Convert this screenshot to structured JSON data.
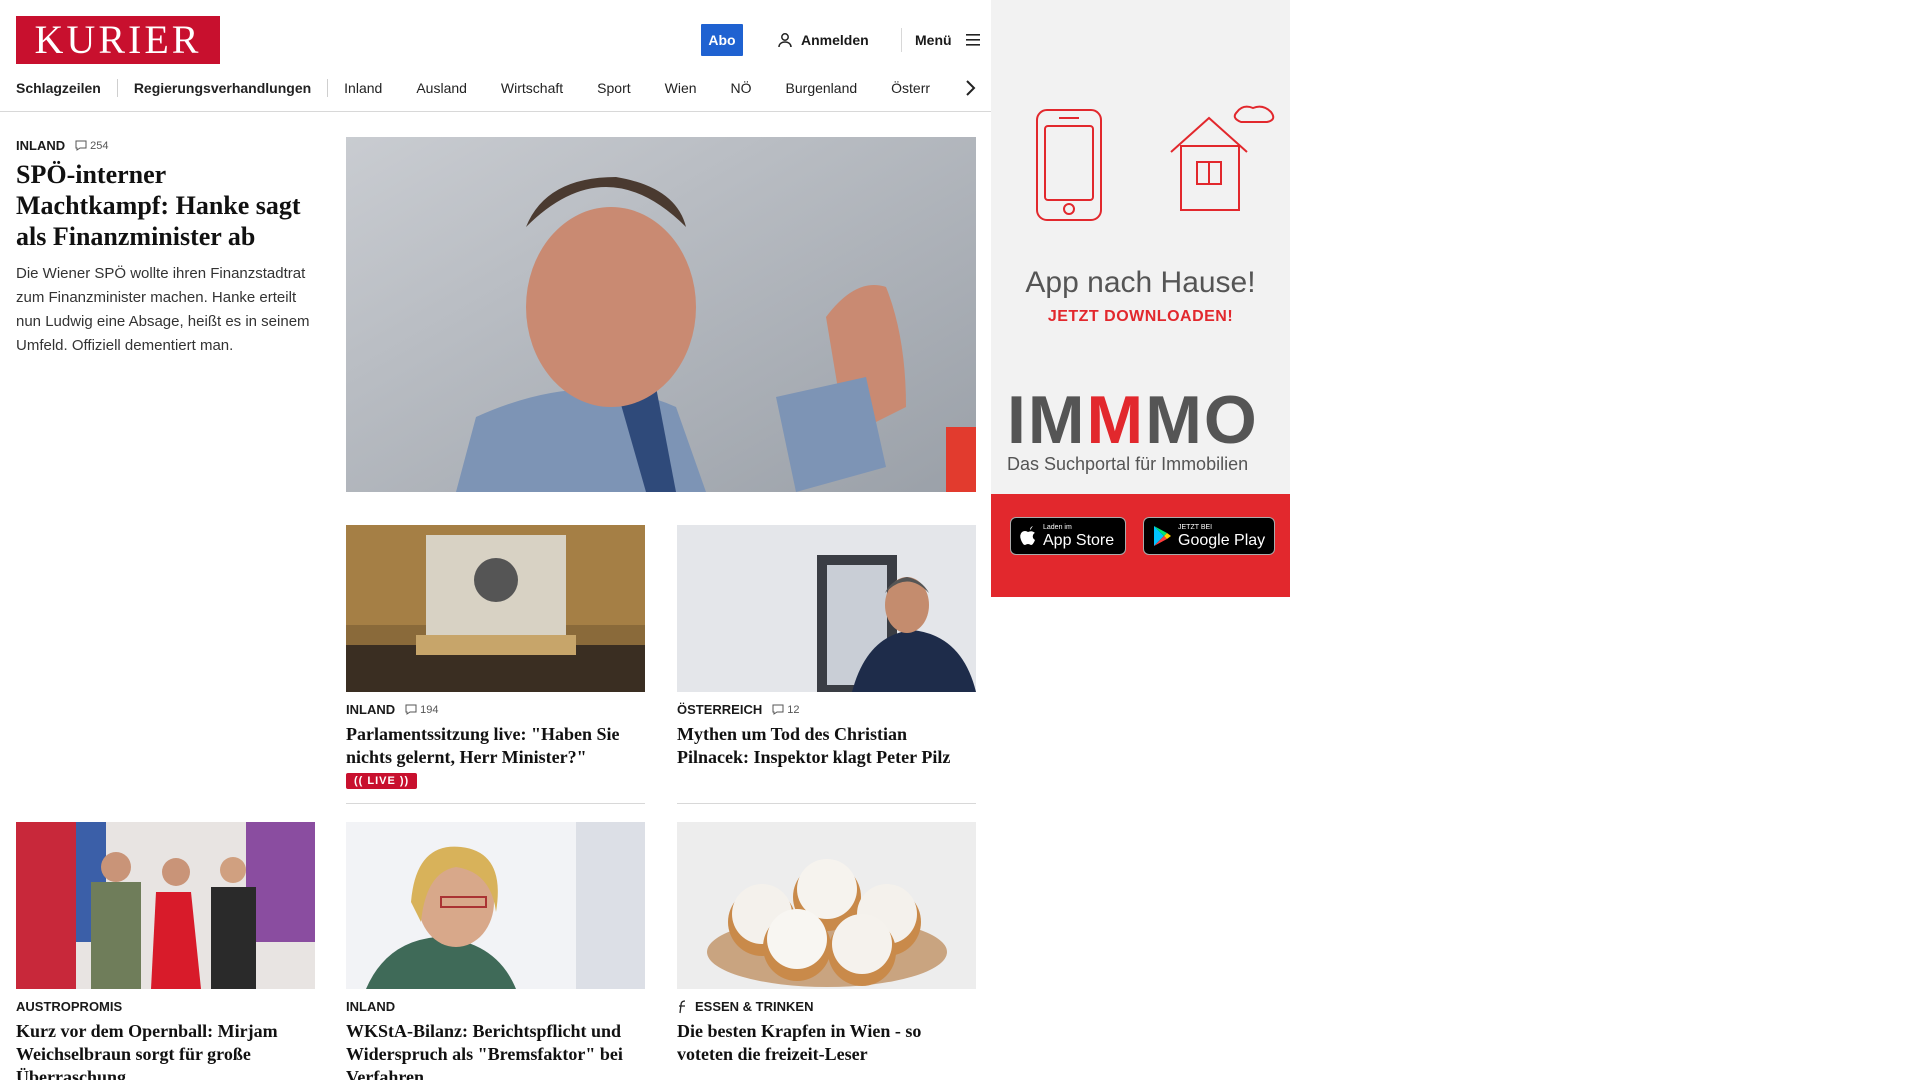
{
  "header": {
    "logo": "KURIER",
    "abo_label": "Abo",
    "login_label": "Anmelden",
    "menu_label": "Menü"
  },
  "nav": {
    "items": [
      "Schlagzeilen",
      "Regierungsverhandlungen",
      "Inland",
      "Ausland",
      "Wirtschaft",
      "Sport",
      "Wien",
      "NÖ",
      "Burgenland",
      "Österr"
    ]
  },
  "lead": {
    "kicker": "INLAND",
    "comments": "254",
    "title": "SPÖ-interner Machtkampf: Hanke sagt als Finanzminister ab",
    "teaser": "Die Wiener SPÖ wollte ihren Finanzstadtrat zum Finanzminister machen. Hanke erteilt nun Ludwig eine Absage, heißt es in seinem Umfeld. Offiziell dementiert man."
  },
  "cards": [
    {
      "kicker": "INLAND",
      "comments": "194",
      "title": "Parlamentssitzung live: \"Haben Sie nichts gelernt, Herr Minister?\"",
      "badge": "(( LIVE ))"
    },
    {
      "kicker": "ÖSTERREICH",
      "comments": "12",
      "title": "Mythen um Tod des Christian Pilnacek: Inspektor klagt Peter Pilz"
    },
    {
      "kicker": "AUSTROPROMIS",
      "title": "Kurz vor dem Opernball: Mirjam Weichselbraun sorgt für große Überraschung"
    },
    {
      "kicker": "INLAND",
      "title": "WKStA-Bilanz: Berichtspflicht und Widerspruch als \"Bremsfaktor\" bei Verfahren"
    },
    {
      "kicker": "ESSEN & TRINKEN",
      "title": "Die besten Krapfen in Wien - so voteten die freizeit-Leser"
    }
  ],
  "ad": {
    "title": "App nach Hause!",
    "subtitle": "JETZT DOWNLOADEN!",
    "brand_1": "IM",
    "brand_2": "M",
    "brand_3": "MO",
    "tagline": "Das Suchportal für Immobilien",
    "appstore_small": "Laden im",
    "appstore_big": "App Store",
    "googleplay_small": "JETZT BEI",
    "googleplay_big": "Google Play"
  },
  "colors": {
    "brand_red": "#c8102e",
    "abo_blue": "#1f62d1",
    "ad_red": "#e2282d"
  }
}
